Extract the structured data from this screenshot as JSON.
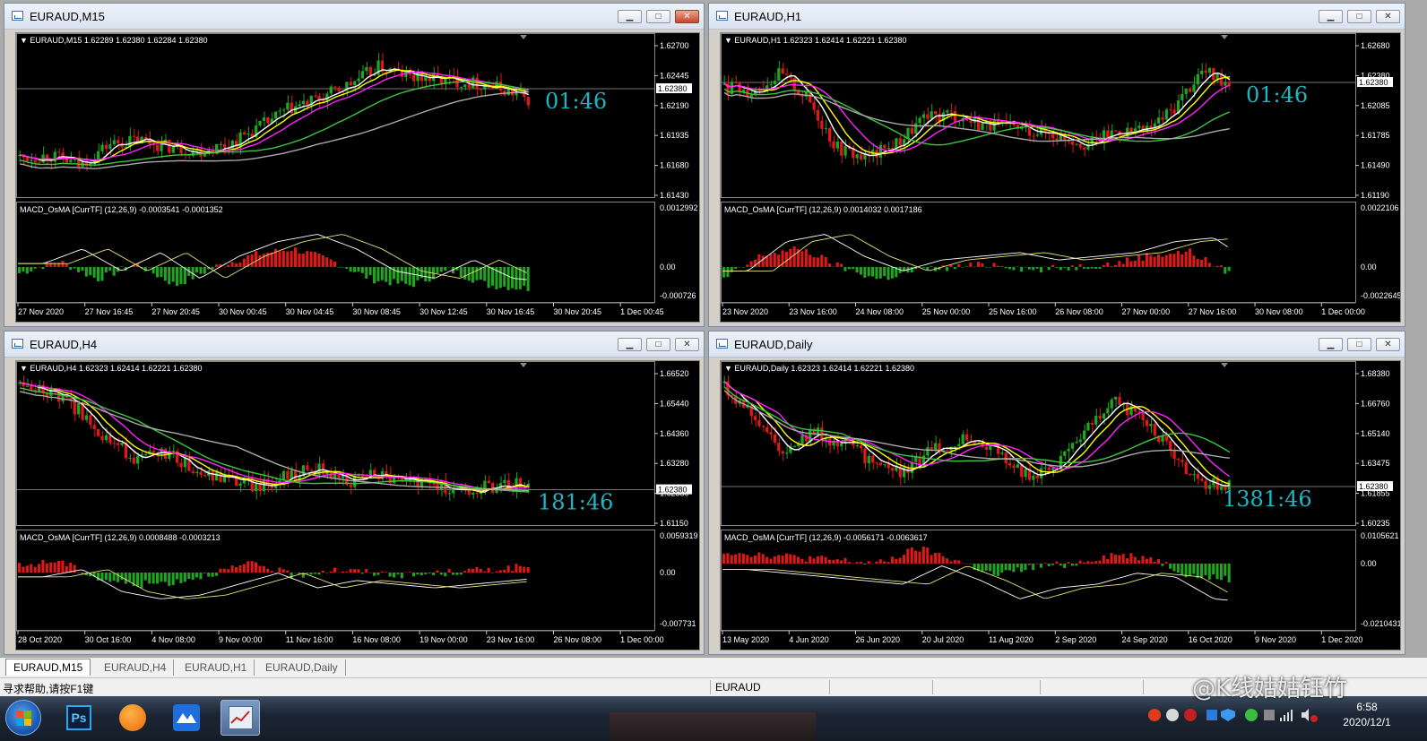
{
  "windows": [
    {
      "title": "EURAUD,M15",
      "header": "EURAUD,M15  1.62289 1.62380 1.62284 1.62380",
      "indicator": "MACD_OsMA [CurrTF] (12,26,9) -0.0003541 -0.0001352",
      "timer": "01:46",
      "current_price": "1.62380",
      "price_ticks": [
        "1.62700",
        "1.62445",
        "1.62190",
        "1.61935",
        "1.61680",
        "1.61430"
      ],
      "macd_ticks": [
        "0.0012992",
        "0.00",
        "-0.000726"
      ],
      "time_ticks": [
        "27 Nov 2020",
        "27 Nov 16:45",
        "27 Nov 20:45",
        "30 Nov 00:45",
        "30 Nov 04:45",
        "30 Nov 08:45",
        "30 Nov 12:45",
        "30 Nov 16:45",
        "30 Nov 20:45",
        "1 Dec 00:45"
      ],
      "close_button_active": true
    },
    {
      "title": "EURAUD,H1",
      "header": "EURAUD,H1  1.62323 1.62414 1.62221 1.62380",
      "indicator": "MACD_OsMA [CurrTF] (12,26,9) 0.0014032 0.0017186",
      "timer": "01:46",
      "current_price": "1.62380",
      "price_ticks": [
        "1.62680",
        "1.62380",
        "1.62085",
        "1.61785",
        "1.61490",
        "1.61190"
      ],
      "macd_ticks": [
        "0.0022106",
        "0.00",
        "-0.0022645"
      ],
      "time_ticks": [
        "23 Nov 2020",
        "23 Nov 16:00",
        "24 Nov 08:00",
        "25 Nov 00:00",
        "25 Nov 16:00",
        "26 Nov 08:00",
        "27 Nov 00:00",
        "27 Nov 16:00",
        "30 Nov 08:00",
        "1 Dec 00:00"
      ],
      "close_button_active": false
    },
    {
      "title": "EURAUD,H4",
      "header": "EURAUD,H4  1.62323 1.62414 1.62221 1.62380",
      "indicator": "MACD_OsMA [CurrTF] (12,26,9) 0.0008488 -0.0003213",
      "timer": "181:46",
      "current_price": "1.62380",
      "price_ticks": [
        "1.66520",
        "1.65440",
        "1.64360",
        "1.63280",
        "1.62380",
        "1.61150"
      ],
      "macd_ticks": [
        "0.0059319",
        "0.00",
        "-0.007731"
      ],
      "time_ticks": [
        "28 Oct 2020",
        "30 Oct 16:00",
        "4 Nov 08:00",
        "9 Nov 00:00",
        "11 Nov 16:00",
        "16 Nov 08:00",
        "19 Nov 00:00",
        "23 Nov 16:00",
        "26 Nov 08:00",
        "1 Dec 00:00"
      ],
      "close_button_active": false
    },
    {
      "title": "EURAUD,Daily",
      "header": "EURAUD,Daily  1.62323 1.62414 1.62221 1.62380",
      "indicator": "MACD_OsMA [CurrTF] (12,26,9) -0.0056171 -0.0063617",
      "timer": "1381:46",
      "current_price": "1.62380",
      "price_ticks": [
        "1.68380",
        "1.66760",
        "1.65140",
        "1.63475",
        "1.61855",
        "1.60235"
      ],
      "macd_ticks": [
        "0.0105621",
        "0.00",
        "-0.0210431"
      ],
      "time_ticks": [
        "13 May 2020",
        "4 Jun 2020",
        "26 Jun 2020",
        "20 Jul 2020",
        "11 Aug 2020",
        "2 Sep 2020",
        "24 Sep 2020",
        "16 Oct 2020",
        "9 Nov 2020",
        "1 Dec 2020"
      ],
      "close_button_active": false
    }
  ],
  "tabs": [
    "EURAUD,M15",
    "EURAUD,H4",
    "EURAUD,H1",
    "EURAUD,Daily"
  ],
  "active_tab": 0,
  "status": {
    "help": "寻求帮助,请按F1键",
    "symbol": "EURAUD"
  },
  "taskbar": {
    "apps": [
      "windows-start-icon",
      "photoshop-icon",
      "sogou-app-icon",
      "feishu-app-icon",
      "metatrader-app-icon"
    ],
    "time": "6:58",
    "date": "2020/12/1"
  },
  "watermark": "@K线姑姑钰竹",
  "colors": {
    "bull": "#1fa51f",
    "bear": "#e01818",
    "timer": "#1fb6c3",
    "ma_white": "#ffffff",
    "ma_yellow": "#ffff00",
    "ma_magenta": "#ff22ff",
    "ma_green": "#3bc83b",
    "ma_gray": "#aaaaaa"
  }
}
